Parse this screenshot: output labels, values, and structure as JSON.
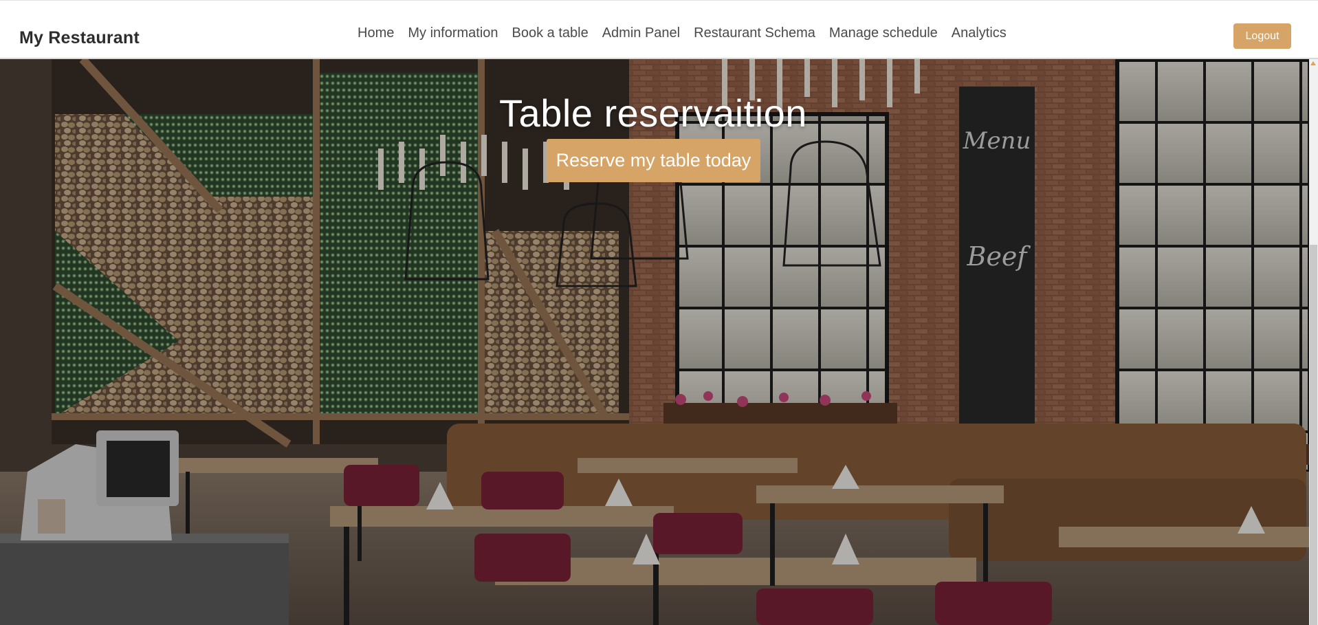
{
  "navbar": {
    "brand": "My Restaurant",
    "links": [
      {
        "label": "Home"
      },
      {
        "label": "My information"
      },
      {
        "label": "Book a table"
      },
      {
        "label": "Admin Panel"
      },
      {
        "label": "Restaurant Schema"
      },
      {
        "label": "Manage schedule"
      },
      {
        "label": "Analytics"
      }
    ],
    "logout_label": "Logout"
  },
  "hero": {
    "title": "Table reservaition",
    "button_label": "Reserve my table today"
  },
  "colors": {
    "accent": "#d6a466",
    "nav_text": "#4a4a4a",
    "hero_overlay": "#000000"
  }
}
